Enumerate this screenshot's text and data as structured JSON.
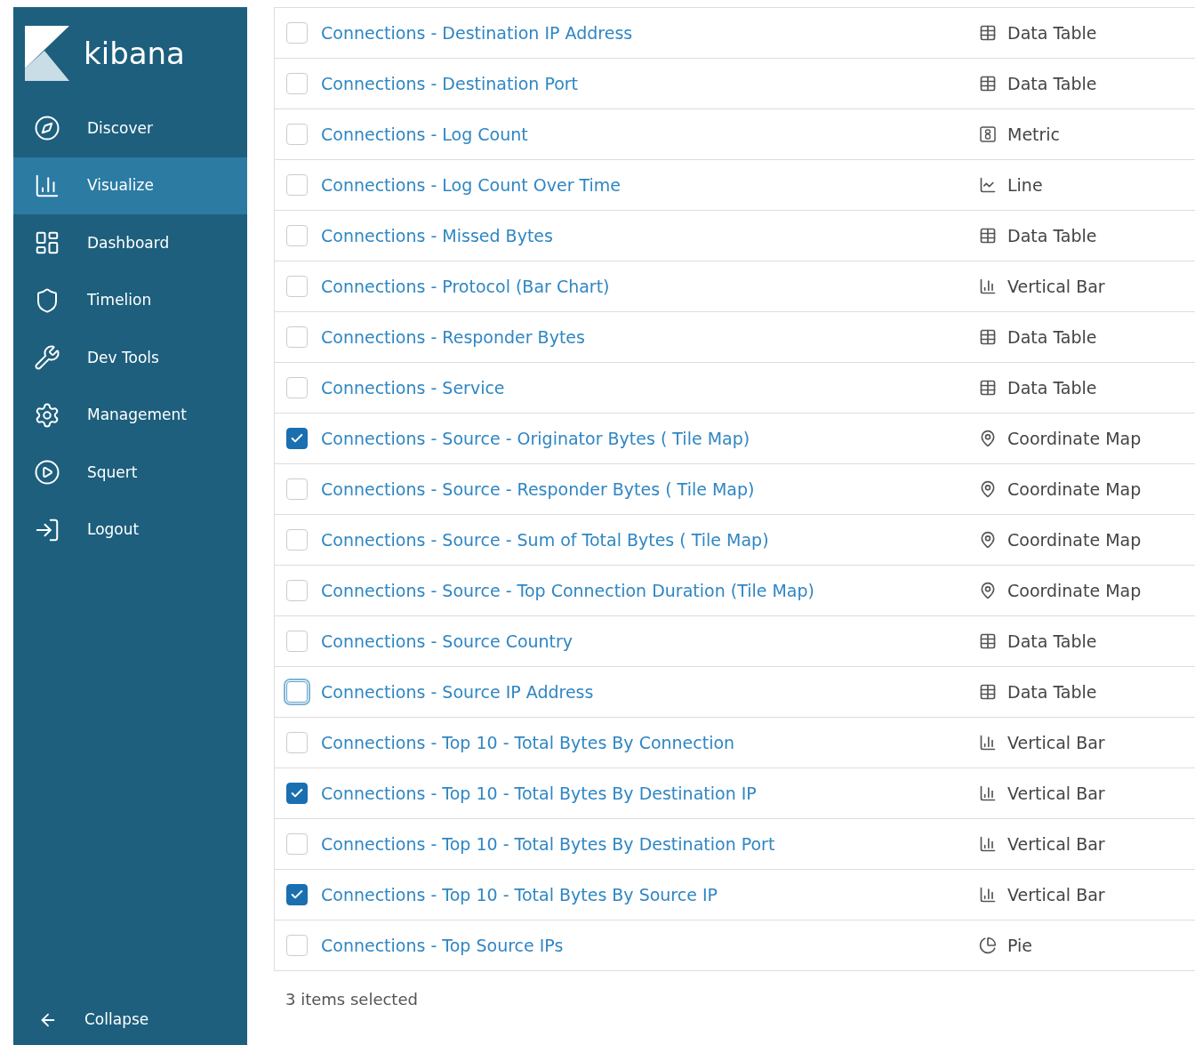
{
  "sidebar": {
    "logo_text": "kibana",
    "items": [
      {
        "label": "Discover",
        "kind": "discover",
        "selected": false
      },
      {
        "label": "Visualize",
        "kind": "visualize",
        "selected": true
      },
      {
        "label": "Dashboard",
        "kind": "dashboard",
        "selected": false
      },
      {
        "label": "Timelion",
        "kind": "timelion",
        "selected": false
      },
      {
        "label": "Dev Tools",
        "kind": "devtools",
        "selected": false
      },
      {
        "label": "Management",
        "kind": "management",
        "selected": false
      },
      {
        "label": "Squert",
        "kind": "squert",
        "selected": false
      },
      {
        "label": "Logout",
        "kind": "logout",
        "selected": false
      }
    ],
    "collapse": "Collapse"
  },
  "table": {
    "rows": [
      {
        "title": "Connections - Destination IP Address",
        "type": "Data Table",
        "kind": "table",
        "checked": false,
        "focused": false
      },
      {
        "title": "Connections - Destination Port",
        "type": "Data Table",
        "kind": "table",
        "checked": false,
        "focused": false
      },
      {
        "title": "Connections - Log Count",
        "type": "Metric",
        "kind": "metric",
        "checked": false,
        "focused": false
      },
      {
        "title": "Connections - Log Count Over Time",
        "type": "Line",
        "kind": "line",
        "checked": false,
        "focused": false
      },
      {
        "title": "Connections - Missed Bytes",
        "type": "Data Table",
        "kind": "table",
        "checked": false,
        "focused": false
      },
      {
        "title": "Connections - Protocol (Bar Chart)",
        "type": "Vertical Bar",
        "kind": "bar",
        "checked": false,
        "focused": false
      },
      {
        "title": "Connections - Responder Bytes",
        "type": "Data Table",
        "kind": "table",
        "checked": false,
        "focused": false
      },
      {
        "title": "Connections - Service",
        "type": "Data Table",
        "kind": "table",
        "checked": false,
        "focused": false
      },
      {
        "title": "Connections - Source - Originator Bytes ( Tile Map)",
        "type": "Coordinate Map",
        "kind": "map",
        "checked": true,
        "focused": false
      },
      {
        "title": "Connections - Source - Responder Bytes ( Tile Map)",
        "type": "Coordinate Map",
        "kind": "map",
        "checked": false,
        "focused": false
      },
      {
        "title": "Connections - Source - Sum of Total Bytes ( Tile Map)",
        "type": "Coordinate Map",
        "kind": "map",
        "checked": false,
        "focused": false
      },
      {
        "title": "Connections - Source - Top Connection Duration (Tile Map)",
        "type": "Coordinate Map",
        "kind": "map",
        "checked": false,
        "focused": false
      },
      {
        "title": "Connections - Source Country",
        "type": "Data Table",
        "kind": "table",
        "checked": false,
        "focused": false
      },
      {
        "title": "Connections - Source IP Address",
        "type": "Data Table",
        "kind": "table",
        "checked": false,
        "focused": true
      },
      {
        "title": "Connections - Top 10 - Total Bytes By Connection",
        "type": "Vertical Bar",
        "kind": "bar",
        "checked": false,
        "focused": false
      },
      {
        "title": "Connections - Top 10 - Total Bytes By Destination IP",
        "type": "Vertical Bar",
        "kind": "bar",
        "checked": true,
        "focused": false
      },
      {
        "title": "Connections - Top 10 - Total Bytes By Destination Port",
        "type": "Vertical Bar",
        "kind": "bar",
        "checked": false,
        "focused": false
      },
      {
        "title": "Connections - Top 10 - Total Bytes By Source IP",
        "type": "Vertical Bar",
        "kind": "bar",
        "checked": true,
        "focused": false
      },
      {
        "title": "Connections - Top Source IPs",
        "type": "Pie",
        "kind": "pie",
        "checked": false,
        "focused": false
      }
    ]
  },
  "footer": {
    "selection_count": "3 items selected"
  }
}
